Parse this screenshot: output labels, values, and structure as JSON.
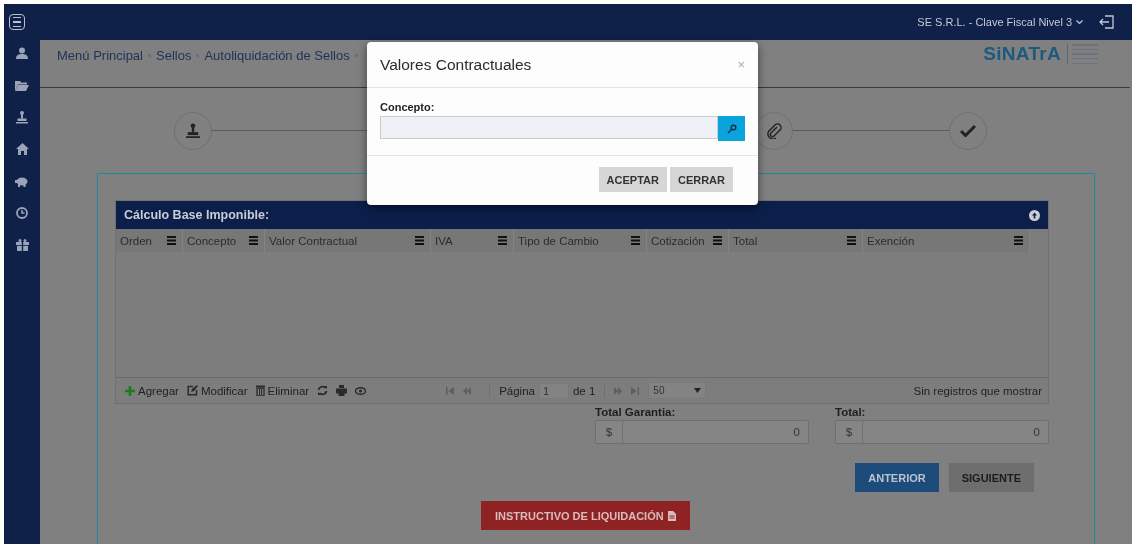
{
  "header": {
    "account": "SE S.R.L. - Clave Fiscal Nivel 3"
  },
  "sidebar": {
    "items": [
      {
        "kind": "user"
      },
      {
        "kind": "folder"
      },
      {
        "kind": "stamp"
      },
      {
        "kind": "home"
      },
      {
        "kind": "piggy"
      },
      {
        "kind": "clock"
      },
      {
        "kind": "gift"
      }
    ]
  },
  "breadcrumb": [
    "Menú Principal",
    "Sellos",
    "Autoliquidación de Sellos"
  ],
  "logo": {
    "text": "SiNATrA"
  },
  "steps": [
    {
      "kind": "stamp"
    },
    {
      "kind": "hidden"
    },
    {
      "kind": "paperclip"
    },
    {
      "kind": "check"
    }
  ],
  "grid": {
    "title": "Cálculo Base Imponible:",
    "columns": [
      "Orden",
      "Concepto",
      "Valor Contractual",
      "IVA",
      "Tipo de Cambio",
      "Cotización",
      "Total",
      "Exención"
    ],
    "toolbar": [
      {
        "kind": "add",
        "label": "Agregar"
      },
      {
        "kind": "edit",
        "label": "Modificar"
      },
      {
        "kind": "delete",
        "label": "Eliminar"
      },
      {
        "kind": "refresh"
      },
      {
        "kind": "print"
      },
      {
        "kind": "view"
      }
    ],
    "pager": {
      "label": "Página",
      "page": "1",
      "of": "de 1",
      "page_size": "50",
      "status": "Sin registros que mostrar"
    }
  },
  "totals": [
    {
      "label": "Total Garantia:",
      "currency": "$",
      "value": "0"
    },
    {
      "label": "Total:",
      "currency": "$",
      "value": "0"
    }
  ],
  "nav_buttons": [
    {
      "label": "ANTERIOR",
      "kind": "primary"
    },
    {
      "label": "SIGUIENTE",
      "kind": "secondary"
    }
  ],
  "instructions_button": {
    "label": "INSTRUCTIVO DE LIQUIDACIÓN"
  },
  "modal": {
    "title": "Valores Contractuales",
    "close": "×",
    "field": {
      "label": "Concepto:"
    },
    "buttons": [
      "ACEPTAR",
      "CERRAR"
    ]
  }
}
